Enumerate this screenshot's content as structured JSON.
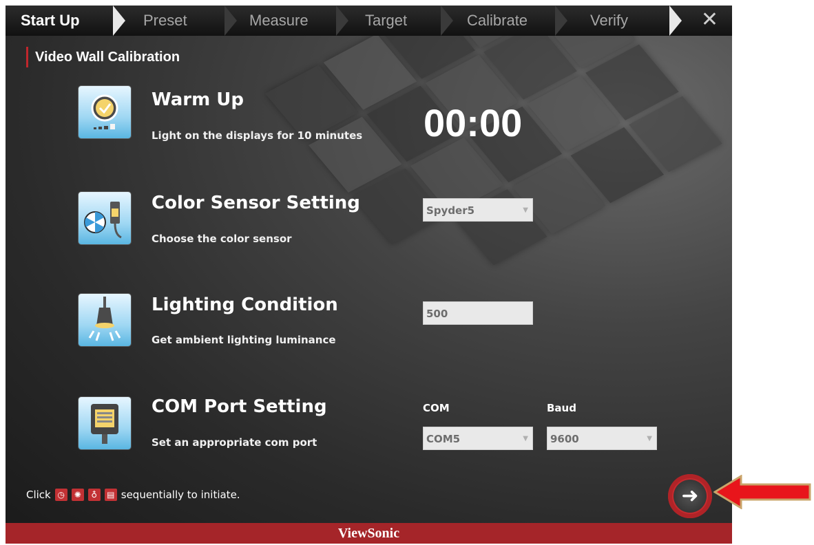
{
  "nav": {
    "steps": [
      "Start Up",
      "Preset",
      "Measure",
      "Target",
      "Calibrate",
      "Verify"
    ],
    "close": "✕"
  },
  "section": {
    "title": "Video Wall Calibration"
  },
  "rows": {
    "warmup": {
      "title": "Warm Up",
      "desc": "Light on the displays for 10 minutes",
      "timer": "00:00"
    },
    "sensor": {
      "title": "Color Sensor Setting",
      "desc": "Choose the color sensor",
      "value": "Spyder5"
    },
    "lighting": {
      "title": "Lighting Condition",
      "desc": "Get ambient lighting luminance",
      "value": "500"
    },
    "comport": {
      "title": "COM Port Setting",
      "desc": "Set an appropriate com port",
      "com_label": "COM",
      "baud_label": "Baud",
      "com_value": "COM5",
      "baud_value": "9600"
    }
  },
  "bottom": {
    "prefix": "Click",
    "suffix": "sequentially to initiate."
  },
  "footer": {
    "brand": "ViewSonic"
  },
  "colors": {
    "accent": "#c0262c",
    "footer": "#a52529"
  }
}
